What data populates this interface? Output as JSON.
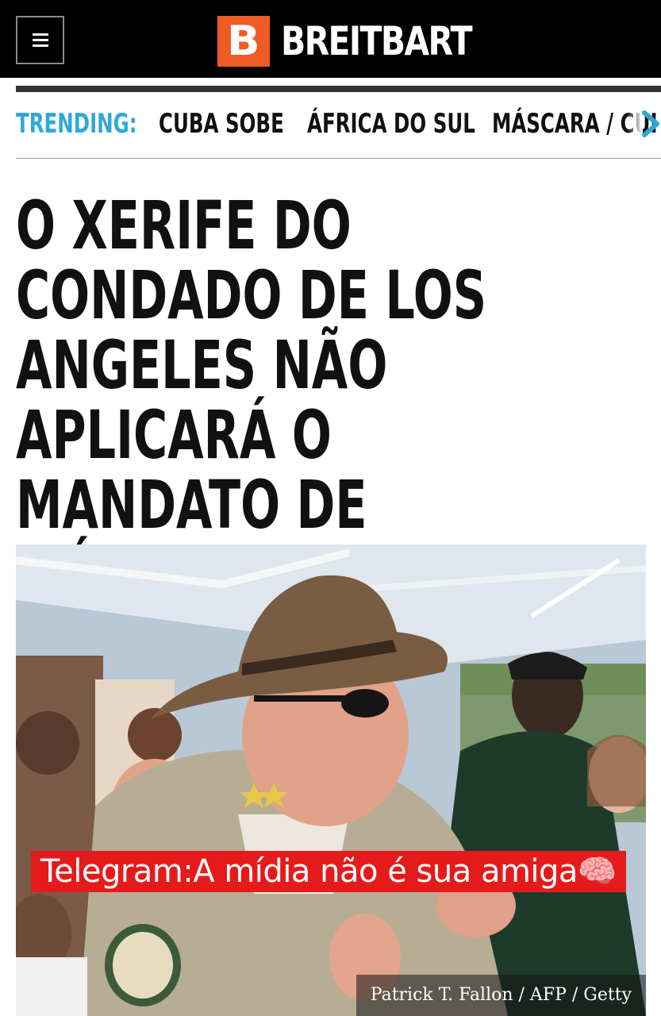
{
  "header": {
    "logo_letter": "B",
    "logo_text": "BREITBART",
    "menu_icon": "hamburger-menu-icon",
    "background_color": "#000000",
    "logo_color": "#ef5b25"
  },
  "trending": {
    "label": "TRENDING:",
    "label_color": "#2fa8d8",
    "items": [
      "CUBA SOBE",
      "ÁFRICA DO SUL",
      "MÁSCARA / CUI"
    ],
    "next_icon": "chevron-right-icon"
  },
  "article": {
    "headline": "O XERIFE DO CONDADO DE LOS ANGELES NÃO APLICARÁ O MANDATO DE MÁSCARA INTERNA RESTABELECIDA",
    "image": {
      "overlay_text": "Telegram:A mídia não é sua amiga🧠",
      "overlay_color": "#e51b1b",
      "credit": "Patrick T. Fallon / AFP / Getty"
    }
  }
}
